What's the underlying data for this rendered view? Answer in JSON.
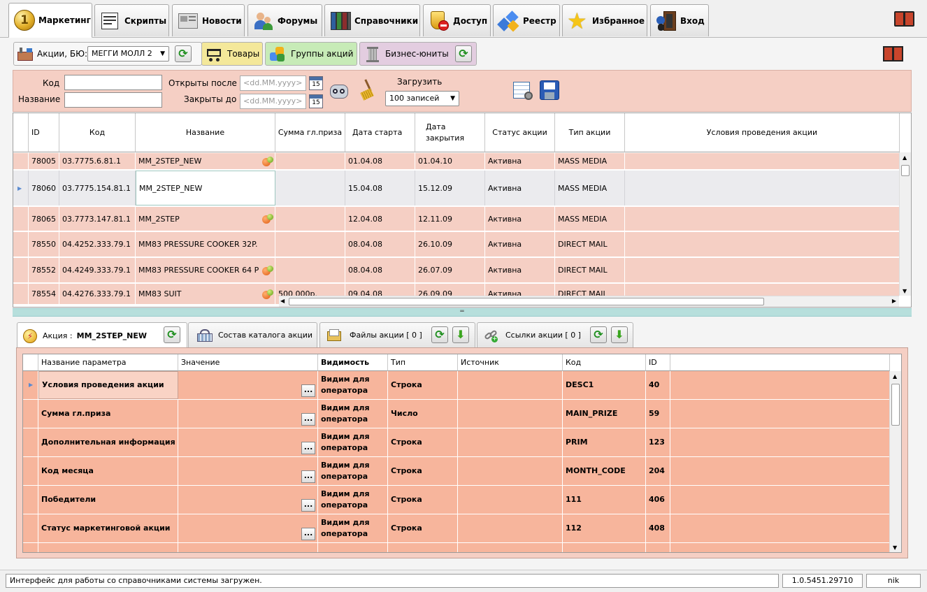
{
  "top_tabs": [
    {
      "label": "Маркетинг",
      "icon": "coin-icon",
      "active": true
    },
    {
      "label": "Скрипты",
      "icon": "script-icon"
    },
    {
      "label": "Новости",
      "icon": "news-icon"
    },
    {
      "label": "Форумы",
      "icon": "forum-users-icon"
    },
    {
      "label": "Справочники",
      "icon": "books-icon"
    },
    {
      "label": "Доступ",
      "icon": "shield-icon"
    },
    {
      "label": "Реестр",
      "icon": "cubes-icon"
    },
    {
      "label": "Избранное",
      "icon": "star-icon"
    },
    {
      "label": "Вход",
      "icon": "door-icon"
    }
  ],
  "subbar": {
    "actions_label": "Акции, БЮ:",
    "bu_select": "МЕГГИ МОЛЛ 2",
    "tab_goods": "Товары",
    "tab_groups": "Группы акций",
    "tab_units": "Бизнес-юниты"
  },
  "filter": {
    "code_label": "Код",
    "name_label": "Название",
    "opened_after_label": "Открыты после",
    "closed_before_label": "Закрыты до",
    "date_placeholder": "<dd.MM.yyyy>",
    "calendar_day": "15",
    "load_label": "Загрузить",
    "load_select": "100 записей"
  },
  "grid1": {
    "columns": [
      "ID",
      "Код",
      "Название",
      "Сумма гл.приза",
      "Дата старта",
      "Дата закрытия",
      "Статус акции",
      "Тип акции",
      "Условия проведения акции"
    ],
    "rows": [
      {
        "id": "78005",
        "code": "03.7775.6.81.1",
        "name": "MM_2STEP_NEW",
        "prize": "",
        "start": "01.04.08",
        "end": "01.04.10",
        "status": "Активна",
        "type": "MASS MEDIA",
        "conditions": "",
        "fruit": true
      },
      {
        "id": "78060",
        "code": "03.7775.154.81.1",
        "name": "MM_2STEP_NEW",
        "prize": "",
        "start": "15.04.08",
        "end": "15.12.09",
        "status": "Активна",
        "type": "MASS MEDIA",
        "conditions": "",
        "fruit": false,
        "selected": true
      },
      {
        "id": "78065",
        "code": "03.7773.147.81.1",
        "name": "MM_2STEP",
        "prize": "",
        "start": "12.04.08",
        "end": "12.11.09",
        "status": "Активна",
        "type": "MASS MEDIA",
        "conditions": "",
        "fruit": true
      },
      {
        "id": "78550",
        "code": "04.4252.333.79.1",
        "name": "MM83 PRESSURE COOKER 32P.",
        "prize": "",
        "start": "08.04.08",
        "end": "26.10.09",
        "status": "Активна",
        "type": "DIRECT MAIL",
        "conditions": "",
        "fruit": false
      },
      {
        "id": "78552",
        "code": "04.4249.333.79.1",
        "name": "MM83 PRESSURE COOKER 64 P",
        "prize": "",
        "start": "08.04.08",
        "end": "26.07.09",
        "status": "Активна",
        "type": "DIRECT MAIL",
        "conditions": "",
        "fruit": true
      },
      {
        "id": "78554",
        "code": "04.4276.333.79.1",
        "name": "MM83 SUIT",
        "prize": "500 000р.",
        "start": "09.04.08",
        "end": "26.09.09",
        "status": "Активна",
        "type": "DIRECT MAIL",
        "conditions": "",
        "fruit": true
      }
    ]
  },
  "bottom_tabs": {
    "action_label": "Акция :",
    "action_name": "MM_2STEP_NEW",
    "catalog": "Состав каталога акции",
    "files": "Файлы акции [ 0 ]",
    "links": "Ссылки акции [ 0 ]"
  },
  "grid2": {
    "columns": [
      "Название параметра",
      "Значение",
      "Видимость",
      "Тип",
      "Источник",
      "Код",
      "ID"
    ],
    "rows": [
      {
        "name": "Условия проведения акции",
        "value": "",
        "visibility": "Видим для оператора",
        "type": "Строка",
        "source": "",
        "code": "DESC1",
        "id": "40"
      },
      {
        "name": "Сумма гл.приза",
        "value": "",
        "visibility": "Видим для оператора",
        "type": "Число",
        "source": "",
        "code": "MAIN_PRIZE",
        "id": "59"
      },
      {
        "name": "Дополнительная информация",
        "value": "",
        "visibility": "Видим для оператора",
        "type": "Строка",
        "source": "",
        "code": "PRIM",
        "id": "123"
      },
      {
        "name": "Код месяца",
        "value": "",
        "visibility": "Видим для оператора",
        "type": "Строка",
        "source": "",
        "code": "MONTH_CODE",
        "id": "204"
      },
      {
        "name": "Победители",
        "value": "",
        "visibility": "Видим для оператора",
        "type": "Строка",
        "source": "",
        "code": "111",
        "id": "406"
      },
      {
        "name": "Статус маркетинговой акции",
        "value": "",
        "visibility": "Видим для оператора",
        "type": "Строка",
        "source": "",
        "code": "112",
        "id": "408"
      },
      {
        "name": "",
        "value": "",
        "visibility": "Видим для",
        "type": "",
        "source": "",
        "code": "",
        "id": ""
      }
    ],
    "dots_label": "..."
  },
  "status": {
    "message": "Интерфейс для работы со справочниками системы загружен.",
    "version": "1.0.5451.29710",
    "user": "nik"
  },
  "colors": {
    "row_bg": "#f5cfc4",
    "param_bg": "#f7b59c",
    "selected_row": "#ebebee",
    "splitter": "#b7dfdc"
  }
}
